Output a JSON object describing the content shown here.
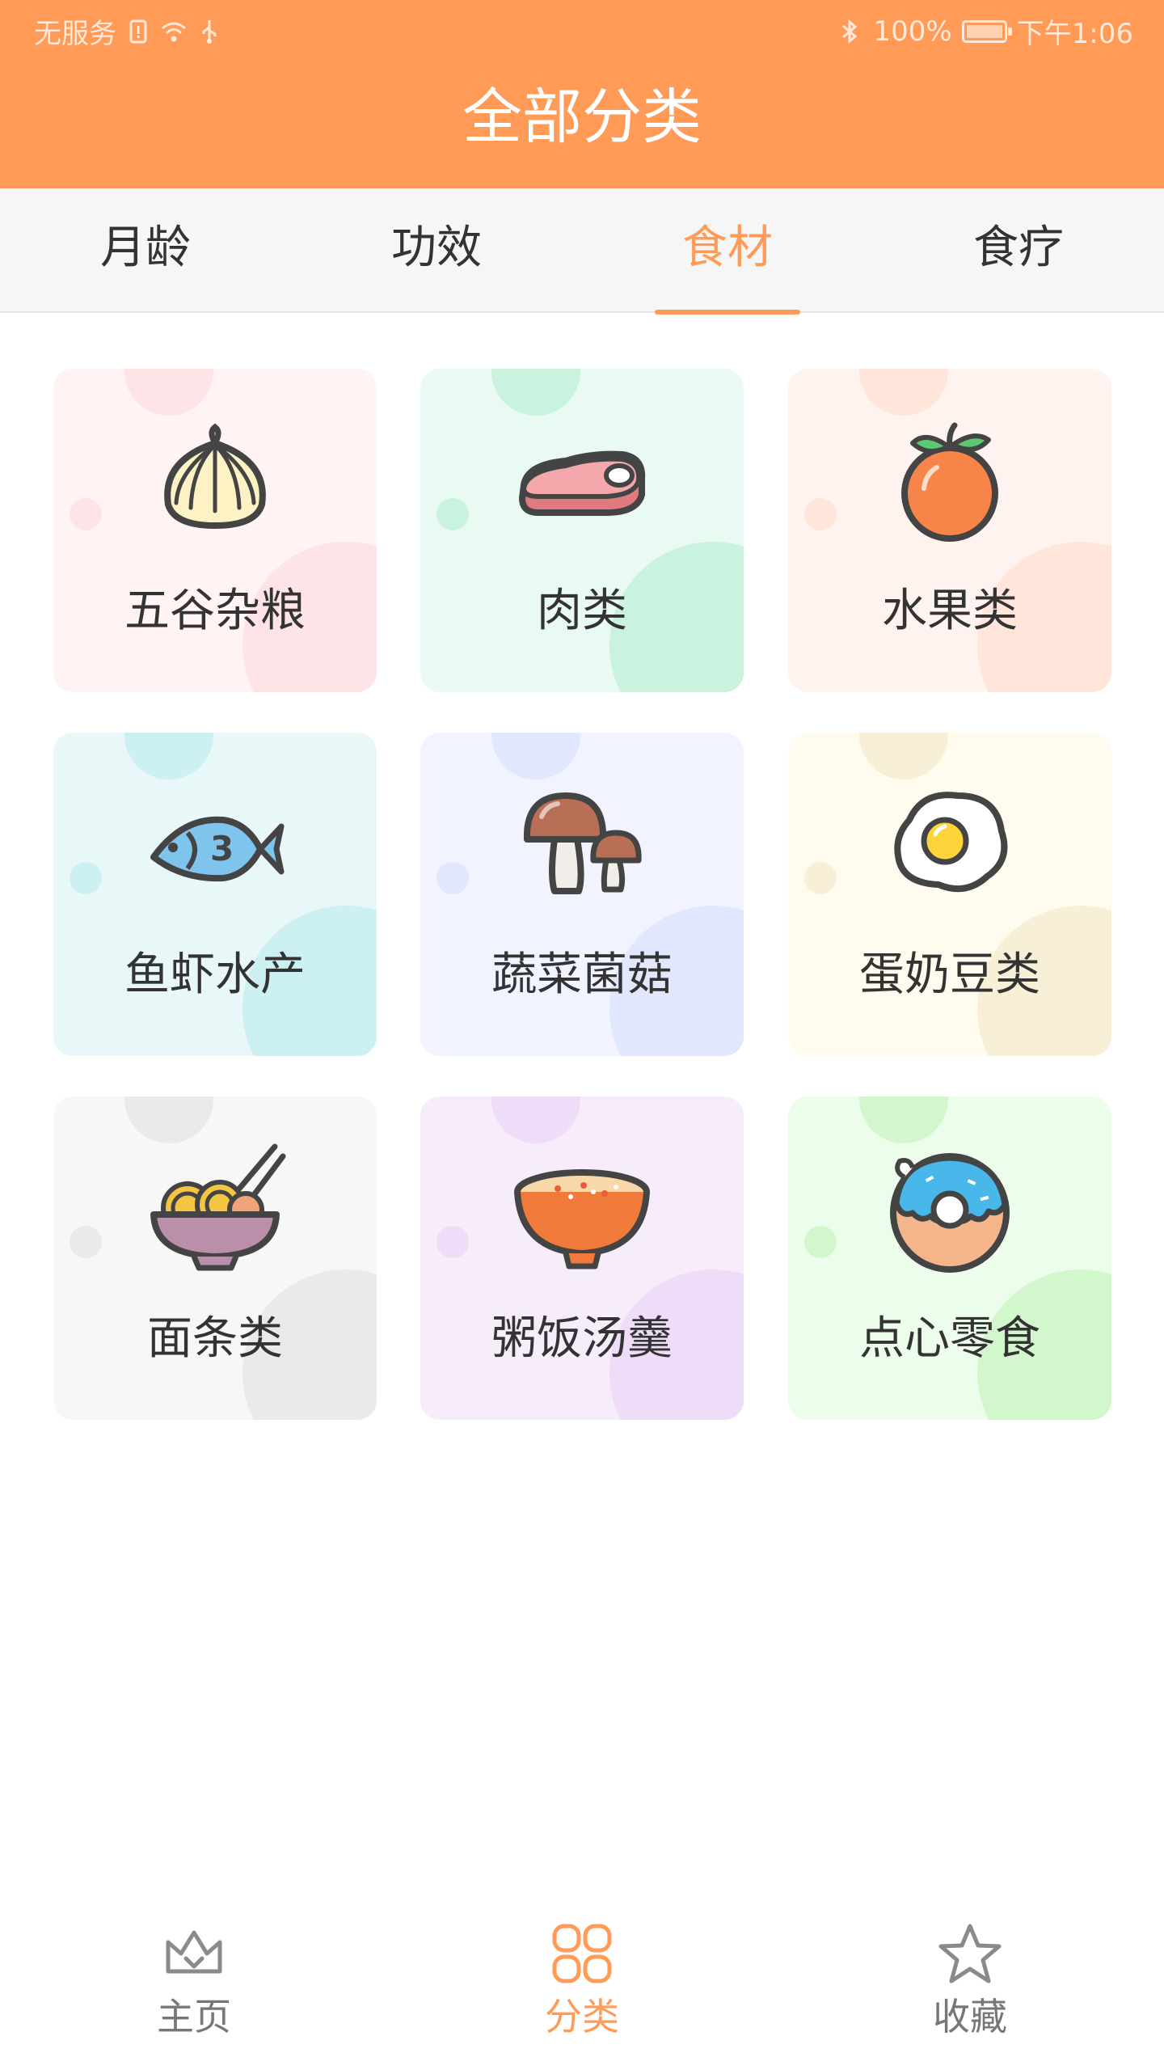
{
  "status_bar": {
    "carrier": "无服务",
    "battery": "100%",
    "time": "下午1:06"
  },
  "header": {
    "title": "全部分类"
  },
  "tabs": [
    {
      "label": "月龄",
      "active": false
    },
    {
      "label": "功效",
      "active": false
    },
    {
      "label": "食材",
      "active": true
    },
    {
      "label": "食疗",
      "active": false
    }
  ],
  "categories": [
    {
      "label": "五谷杂粮",
      "icon": "dumpling-icon",
      "bg": "#fff3f4",
      "bubble": "#ffe4e7"
    },
    {
      "label": "肉类",
      "icon": "steak-icon",
      "bg": "#e8faf1",
      "bubble": "#c9f3de"
    },
    {
      "label": "水果类",
      "icon": "orange-icon",
      "bg": "#fff3ef",
      "bubble": "#ffe5da"
    },
    {
      "label": "鱼虾水产",
      "icon": "fish-icon",
      "bg": "#e8f7f8",
      "bubble": "#cdf0f3"
    },
    {
      "label": "蔬菜菌菇",
      "icon": "mushroom-icon",
      "bg": "#f1f4ff",
      "bubble": "#e1e8fd"
    },
    {
      "label": "蛋奶豆类",
      "icon": "fried-egg-icon",
      "bg": "#fffcef",
      "bubble": "#f7f0d7"
    },
    {
      "label": "面条类",
      "icon": "noodle-bowl-icon",
      "bg": "#f7f7f7",
      "bubble": "#eaeaea"
    },
    {
      "label": "粥饭汤羹",
      "icon": "congee-bowl-icon",
      "bg": "#f6ecfa",
      "bubble": "#eedcf8"
    },
    {
      "label": "点心零食",
      "icon": "donut-icon",
      "bg": "#edfdeb",
      "bubble": "#d3f7cc"
    }
  ],
  "bottom_nav": [
    {
      "label": "主页",
      "icon": "crown-icon",
      "active": false
    },
    {
      "label": "分类",
      "icon": "grid-icon",
      "active": true
    },
    {
      "label": "收藏",
      "icon": "star-icon",
      "active": false
    }
  ],
  "colors": {
    "accent": "#ff9a57",
    "text": "#333333",
    "nav_inactive": "#777777"
  }
}
